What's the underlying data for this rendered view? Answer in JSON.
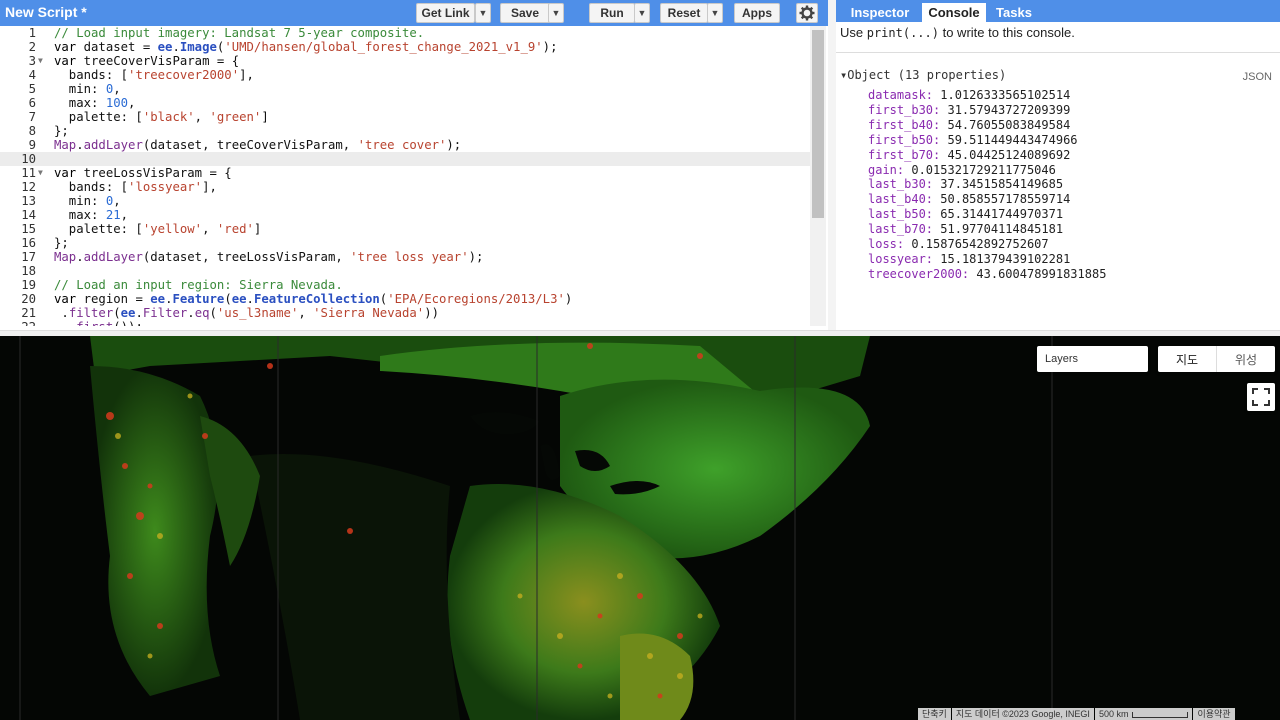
{
  "editor": {
    "title": "New Script *",
    "buttons": {
      "get_link": "Get Link",
      "save": "Save",
      "run": "Run",
      "reset": "Reset",
      "apps": "Apps"
    },
    "line_numbers": [
      "1",
      "2",
      "3",
      "4",
      "5",
      "6",
      "7",
      "8",
      "9",
      "10",
      "11",
      "12",
      "13",
      "14",
      "15",
      "16",
      "17",
      "18",
      "19",
      "20",
      "21",
      "22"
    ]
  },
  "panel": {
    "tabs": [
      "Inspector",
      "Console",
      "Tasks"
    ],
    "active_tab": "Console",
    "hint_prefix": "Use ",
    "hint_code": "print(...)",
    "hint_suffix": " to write to this console.",
    "object_header": "Object (13 properties)",
    "json_label": "JSON",
    "properties": [
      {
        "key": "datamask:",
        "value": "1.0126333565102514"
      },
      {
        "key": "first_b30:",
        "value": "31.57943727209399"
      },
      {
        "key": "first_b40:",
        "value": "54.76055083849584"
      },
      {
        "key": "first_b50:",
        "value": "59.511449443474966"
      },
      {
        "key": "first_b70:",
        "value": "45.04425124089692"
      },
      {
        "key": "gain:",
        "value": "0.015321729211775046"
      },
      {
        "key": "last_b30:",
        "value": "37.34515854149685"
      },
      {
        "key": "last_b40:",
        "value": "50.858557178559714"
      },
      {
        "key": "last_b50:",
        "value": "65.31441744970371"
      },
      {
        "key": "last_b70:",
        "value": "51.97704114845181"
      },
      {
        "key": "loss:",
        "value": "0.15876542892752607"
      },
      {
        "key": "lossyear:",
        "value": "15.181379439102281"
      },
      {
        "key": "treecover2000:",
        "value": "43.600478991831885"
      }
    ]
  },
  "map": {
    "layers_label": "Layers",
    "map_type": "지도",
    "satellite_type": "위성",
    "attribution": {
      "shortcuts": "단축키",
      "data": "지도 데이터 ©2023 Google, INEGI",
      "scale": "500 km",
      "terms": "이용약관"
    }
  },
  "colors": {
    "header_blue": "#4f8fe8",
    "forest_green": "#2f8f1a",
    "loss_red": "#d43a1c",
    "loss_yellow": "#c9b020"
  }
}
